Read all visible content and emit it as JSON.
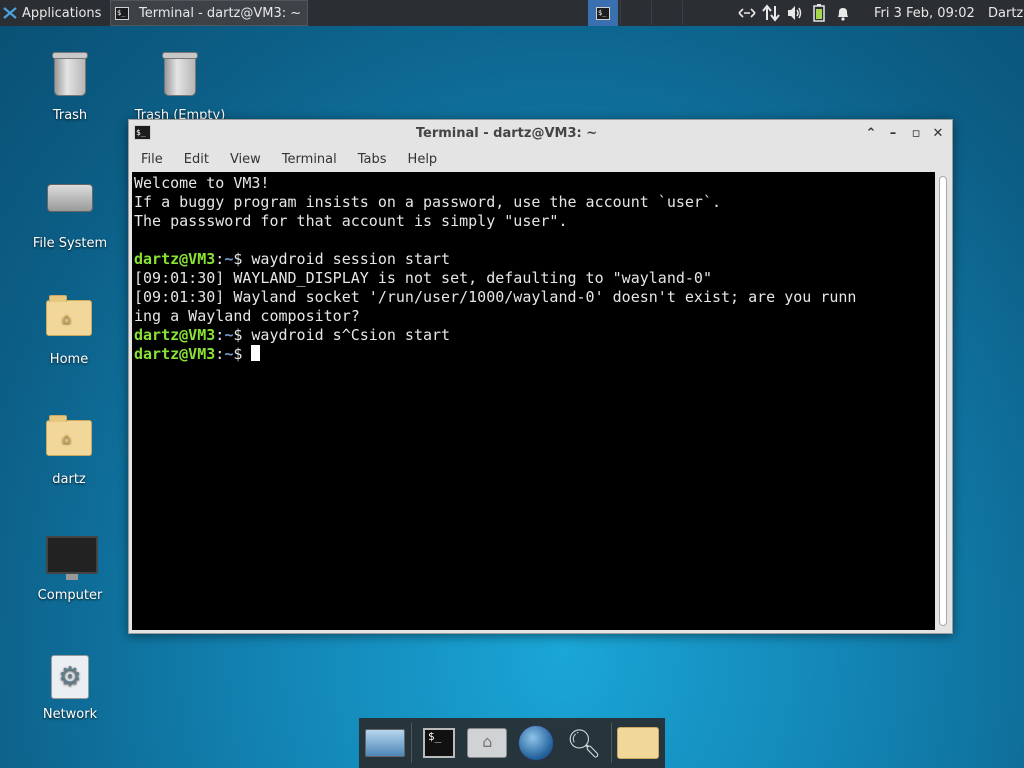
{
  "panel": {
    "applications_label": "Applications",
    "task_title": "Terminal - dartz@VM3: ~",
    "clock": "Fri  3 Feb, 09:02",
    "user": "Dartz"
  },
  "desktop": {
    "icons": [
      {
        "label": "Trash",
        "icon": "trash-icon"
      },
      {
        "label": "Trash (Empty)",
        "icon": "trash-icon"
      },
      {
        "label": "File System",
        "icon": "drive-icon"
      },
      {
        "label": "Home",
        "icon": "home-folder-icon"
      },
      {
        "label": "dartz",
        "icon": "home-folder-icon"
      },
      {
        "label": "Computer",
        "icon": "monitor-icon"
      },
      {
        "label": "Network",
        "icon": "gear-icon"
      }
    ]
  },
  "window": {
    "title": "Terminal - dartz@VM3: ~",
    "menu": [
      "File",
      "Edit",
      "View",
      "Terminal",
      "Tabs",
      "Help"
    ]
  },
  "terminal": {
    "lines": [
      "Welcome to VM3!",
      "If a buggy program insists on a password, use the account `user`.",
      "The passsword for that account is simply \"user\".",
      "",
      "[09:01:30] WAYLAND_DISPLAY is not set, defaulting to \"wayland-0\"",
      "[09:01:30] Wayland socket '/run/user/1000/wayland-0' doesn't exist; are you runn",
      "ing a Wayland compositor?"
    ],
    "prompt_user": "dartz@VM3",
    "prompt_sep": ":",
    "prompt_path": "~",
    "prompt_dollar": "$ ",
    "cmd1": "waydroid session start",
    "cmd2": "waydroid s^Csion start"
  },
  "dock": {
    "items": [
      "show-desktop-icon",
      "terminal-icon",
      "home-icon",
      "web-browser-icon",
      "search-icon",
      "folder-icon"
    ]
  }
}
